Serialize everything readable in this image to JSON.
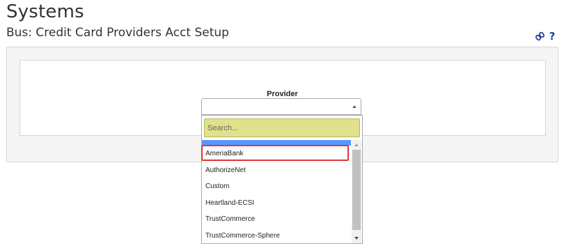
{
  "header": {
    "title": "Systems",
    "subtitle": "Bus: Credit Card Providers Acct Setup",
    "link_icon": "link-icon",
    "help_icon": "help-icon",
    "help_glyph": "?"
  },
  "form": {
    "provider_label": "Provider",
    "provider_value": ""
  },
  "dropdown": {
    "search_placeholder": "Search...",
    "search_value": "",
    "options": [
      "AmeriaBank",
      "AuthorizeNet",
      "Custom",
      "Heartland-ECSI",
      "TrustCommerce",
      "TrustCommerce-Sphere"
    ]
  },
  "colors": {
    "highlight_option": "#5897fb",
    "search_bg": "#dfe28a",
    "annotation_border": "#e0343c",
    "icon_color": "#1f3fa8"
  }
}
